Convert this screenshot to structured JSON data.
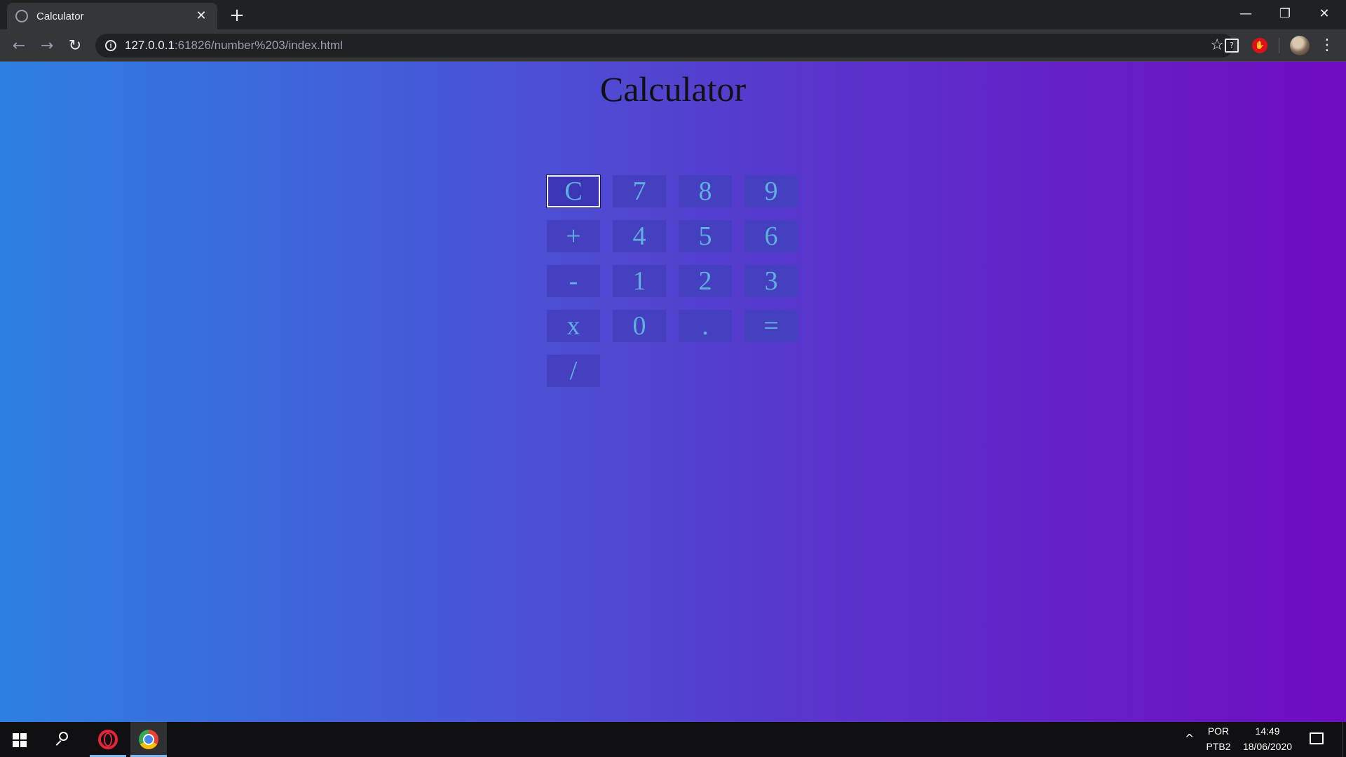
{
  "browser": {
    "tab_title": "Calculator",
    "tab_close": "✕",
    "new_tab": "+",
    "url_host": "127.0.0.1",
    "url_rest": ":61826/number%203/index.html",
    "window_controls": {
      "minimize": "—",
      "maximize": "❐",
      "close": "✕"
    },
    "nav": {
      "back": "←",
      "forward": "→",
      "reload": "↻"
    },
    "star": "☆",
    "menu": "⋮"
  },
  "page": {
    "title": "Calculator",
    "keys": [
      {
        "label": "C",
        "name": "clear-button"
      },
      {
        "label": "7",
        "name": "key-7-button"
      },
      {
        "label": "8",
        "name": "key-8-button"
      },
      {
        "label": "9",
        "name": "key-9-button"
      },
      {
        "label": "+",
        "name": "add-button"
      },
      {
        "label": "4",
        "name": "key-4-button"
      },
      {
        "label": "5",
        "name": "key-5-button"
      },
      {
        "label": "6",
        "name": "key-6-button"
      },
      {
        "label": "-",
        "name": "subtract-button"
      },
      {
        "label": "1",
        "name": "key-1-button"
      },
      {
        "label": "2",
        "name": "key-2-button"
      },
      {
        "label": "3",
        "name": "key-3-button"
      },
      {
        "label": "x",
        "name": "multiply-button"
      },
      {
        "label": "0",
        "name": "key-0-button"
      },
      {
        "label": ".",
        "name": "decimal-button"
      },
      {
        "label": "=",
        "name": "equals-button"
      },
      {
        "label": "/",
        "name": "divide-button"
      }
    ],
    "focused_key": "C",
    "colors": {
      "gradient_start": "#2d80e2",
      "gradient_end": "#700cc0",
      "key_background": "#4440c0",
      "key_text": "#5fb0df"
    }
  },
  "taskbar": {
    "language_top": "POR",
    "language_bottom": "PTB2",
    "time": "14:49",
    "date": "18/06/2020",
    "tray_chevron": "^"
  }
}
